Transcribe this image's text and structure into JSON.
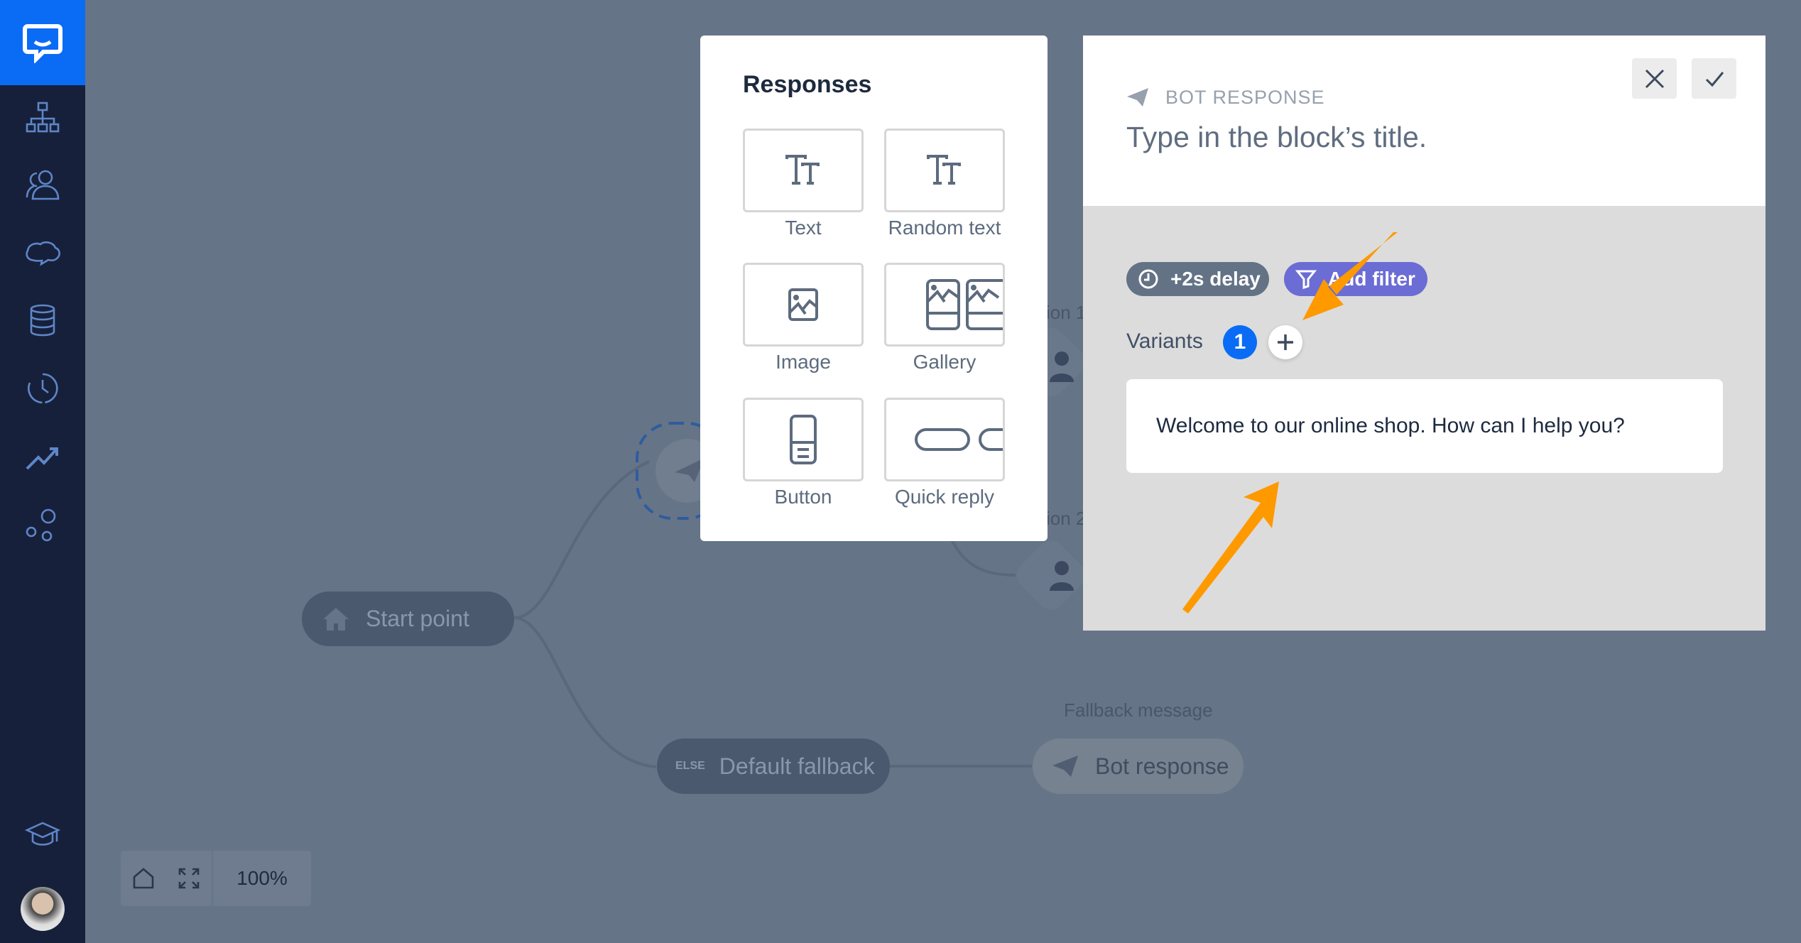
{
  "sidebar": {
    "items": [
      {
        "icon": "sitemap-icon"
      },
      {
        "icon": "users-icon"
      },
      {
        "icon": "chat-cloud-icon"
      },
      {
        "icon": "database-icon"
      },
      {
        "icon": "history-icon"
      },
      {
        "icon": "trending-icon"
      },
      {
        "icon": "integrations-icon"
      },
      {
        "icon": "graduation-cap-icon"
      }
    ]
  },
  "canvas": {
    "start_point": "Start point",
    "else_tag": "ELSE",
    "default_fallback": "Default fallback",
    "fallback_label": "Fallback message",
    "bot_response": "Bot response",
    "partial_labels": [
      "ion 1",
      "ion 2"
    ]
  },
  "toolbar": {
    "zoom": "100%"
  },
  "responses": {
    "title": "Responses",
    "items": [
      {
        "label": "Text"
      },
      {
        "label": "Random text"
      },
      {
        "label": "Image"
      },
      {
        "label": "Gallery"
      },
      {
        "label": "Button"
      },
      {
        "label": "Quick reply"
      }
    ]
  },
  "bot_panel": {
    "type_label": "BOT RESPONSE",
    "title_placeholder": "Type in the block’s title.",
    "delay": "+2s delay",
    "filter": "Add filter",
    "variants_label": "Variants",
    "variants_count": "1",
    "message": "Welcome to our online shop. How can I help you?"
  },
  "colors": {
    "accent": "#0a6cf5",
    "filter_pill": "#6b6cd4",
    "delay_pill": "#637285",
    "arrow": "#ff9900"
  }
}
